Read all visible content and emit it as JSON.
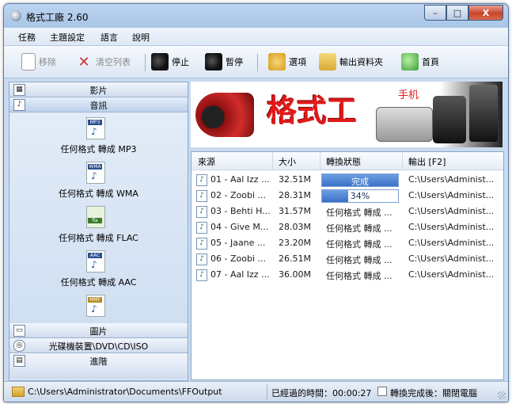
{
  "window": {
    "title": "格式工廠 2.60",
    "minimize": "–",
    "maximize": "□",
    "close": "X"
  },
  "menu": [
    "任務",
    "主題設定",
    "語言",
    "說明"
  ],
  "toolbar": {
    "remove": "移除",
    "clear_list": "清空列表",
    "stop": "停止",
    "pause": "暫停",
    "options": "選項",
    "output_folder": "輸出資料夾",
    "home": "首頁"
  },
  "sidebar": {
    "video": "影片",
    "audio": "音訊",
    "image": "圖片",
    "disc": "光碟機裝置\\DVD\\CD\\ISO",
    "advanced": "進階",
    "formats": [
      {
        "tag": "MP3",
        "label": "任何格式 轉成 MP3"
      },
      {
        "tag": "WMA",
        "label": "任何格式 轉成 WMA"
      },
      {
        "tag": "fla",
        "label": "任何格式 轉成 FLAC"
      },
      {
        "tag": "AAC",
        "label": "任何格式 轉成 AAC"
      },
      {
        "tag": "MMF",
        "label": ""
      }
    ]
  },
  "banner": {
    "logo": "格式工",
    "sub": "手机"
  },
  "table": {
    "headers": {
      "source": "來源",
      "size": "大小",
      "status": "轉換狀態",
      "output": "輸出 [F2]"
    },
    "rows": [
      {
        "source": "01 - Aal Izz ...",
        "size": "32.51M",
        "status": "完成",
        "progress": 1.0,
        "output": "C:\\Users\\Administ..."
      },
      {
        "source": "02 - Zoobi ...",
        "size": "28.31M",
        "status": "34%",
        "progress": 0.34,
        "output": "C:\\Users\\Administ..."
      },
      {
        "source": "03 - Behti H...",
        "size": "31.57M",
        "status": "任何格式 轉成 ...",
        "output": "C:\\Users\\Administ..."
      },
      {
        "source": "04 - Give M...",
        "size": "28.03M",
        "status": "任何格式 轉成 ...",
        "output": "C:\\Users\\Administ..."
      },
      {
        "source": "05 - Jaane ...",
        "size": "23.20M",
        "status": "任何格式 轉成 ...",
        "output": "C:\\Users\\Administ..."
      },
      {
        "source": "06 - Zoobi ...",
        "size": "26.51M",
        "status": "任何格式 轉成 ...",
        "output": "C:\\Users\\Administ..."
      },
      {
        "source": "07 - Aal Izz ...",
        "size": "36.00M",
        "status": "任何格式 轉成 ...",
        "output": "C:\\Users\\Administ..."
      }
    ]
  },
  "status": {
    "path": "C:\\Users\\Administrator\\Documents\\FFOutput",
    "elapsed": "已經過的時間：00:00:27",
    "after": "轉換完成後：關閉電腦"
  }
}
